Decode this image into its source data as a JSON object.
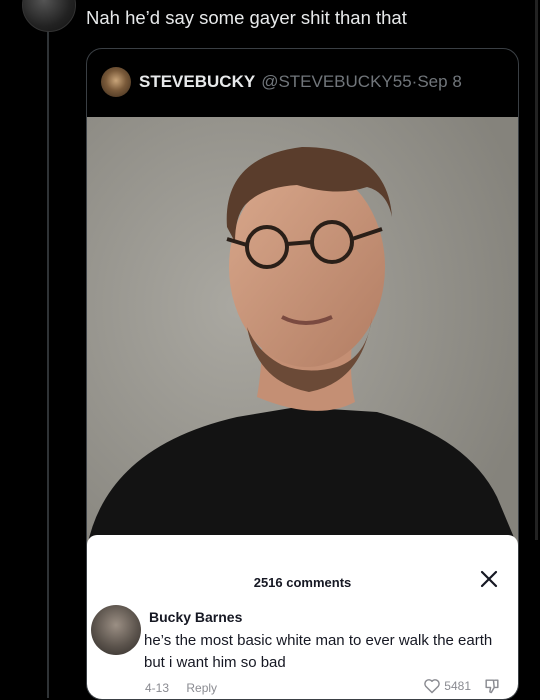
{
  "reply_tweet": {
    "text": "Nah he’d say some gayer shit than that"
  },
  "quoted_tweet": {
    "display_name": "STEVEBUCKY",
    "handle": "@STEVEBUCKY55",
    "date_separator": " · ",
    "date": "Sep 8"
  },
  "comments_panel": {
    "count_label": "2516 comments",
    "comment": {
      "author": "Bucky Barnes",
      "text": "he’s the most basic white man to ever walk the earth but i want him so bad",
      "date": "4-13",
      "reply_label": "Reply",
      "likes": "5481"
    }
  },
  "colors": {
    "background": "#000000",
    "text_primary": "#e7e9ea",
    "text_secondary": "#71767b",
    "card_border": "#3a3f44",
    "sheet_bg": "#ffffff",
    "sheet_text": "#161823",
    "sheet_meta": "#8a8b91"
  },
  "icons": [
    "close-icon",
    "heart-icon",
    "dislike-icon"
  ]
}
